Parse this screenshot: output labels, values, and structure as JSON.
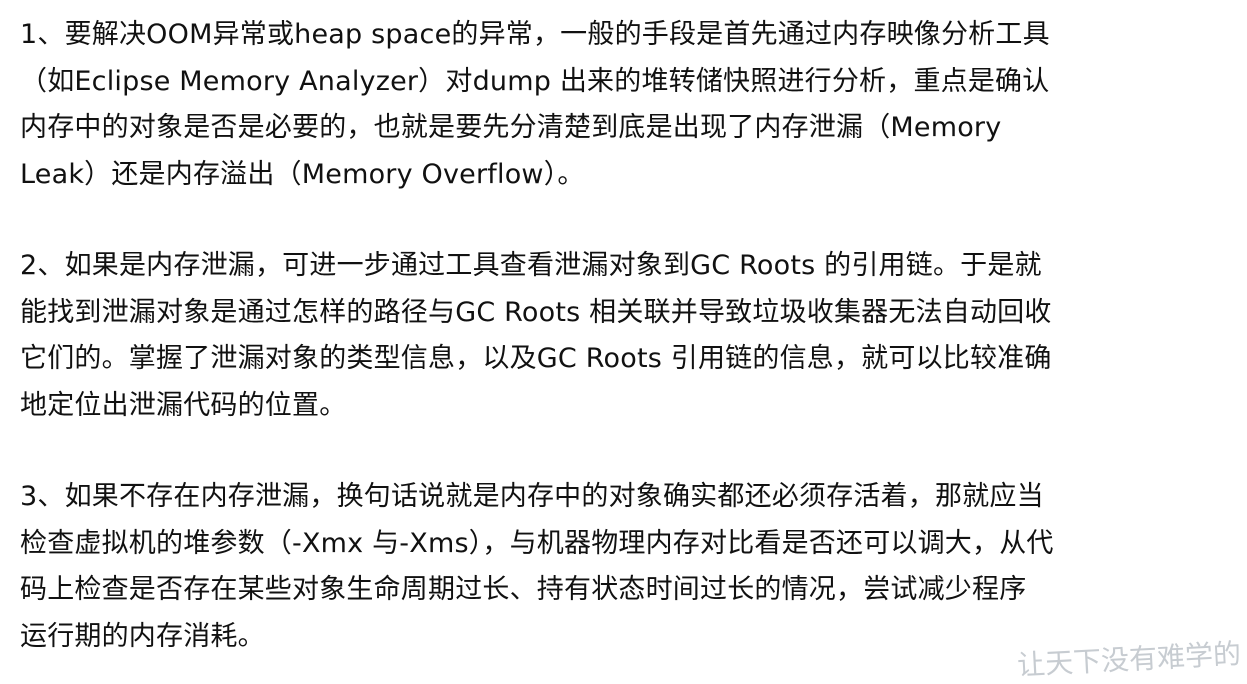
{
  "paragraphs": [
    {
      "lines": [
        "1、要解决OOM异常或heap space的异常，一般的手段是首先通过内存映像分析工具",
        "（如Eclipse Memory Analyzer）对dump 出来的堆转储快照进行分析，重点是确认",
        "内存中的对象是否是必要的，也就是要先分清楚到底是出现了内存泄漏（Memory",
        "Leak）还是内存溢出（Memory Overflow）。"
      ]
    },
    {
      "lines": [
        "2、如果是内存泄漏，可进一步通过工具查看泄漏对象到GC Roots 的引用链。于是就",
        "能找到泄漏对象是通过怎样的路径与GC Roots 相关联并导致垃圾收集器无法自动回收",
        "它们的。掌握了泄漏对象的类型信息，以及GC Roots 引用链的信息，就可以比较准确",
        "地定位出泄漏代码的位置。"
      ]
    },
    {
      "lines": [
        "3、如果不存在内存泄漏，换句话说就是内存中的对象确实都还必须存活着，那就应当",
        "检查虚拟机的堆参数（-Xmx 与-Xms），与机器物理内存对比看是否还可以调大，从代",
        "码上检查是否存在某些对象生命周期过长、持有状态时间过长的情况，尝试减少程序",
        "运行期的内存消耗。"
      ]
    }
  ],
  "watermark": "让天下没有难学的"
}
